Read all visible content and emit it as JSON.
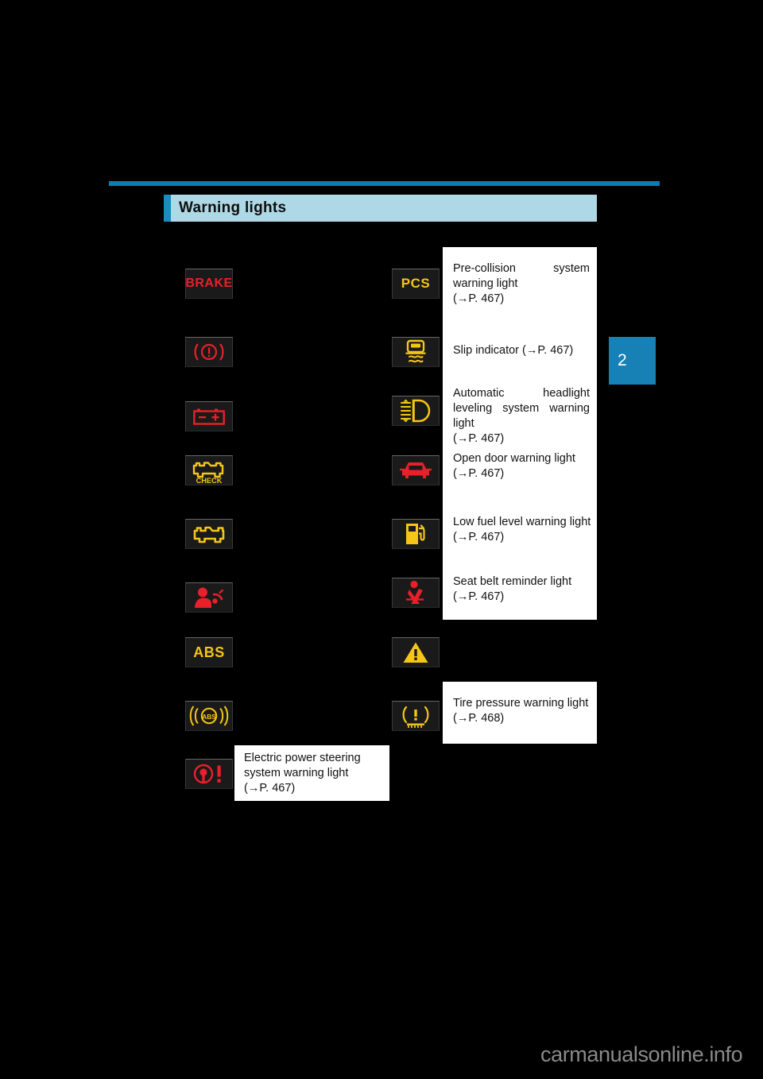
{
  "page": {
    "background_color": "#000000",
    "section_title": "Warning lights",
    "chapter_tab": "2",
    "watermark": "carmanualsonline.info",
    "accent_color": "#1a8dc0",
    "header_band_color": "#aed8e6",
    "rule_color": "#0d7cb5"
  },
  "left_column": [
    {
      "icon": "brake-warning-icon",
      "label_text": "BRAKE",
      "color": "#e8202a"
    },
    {
      "icon": "brake-system-circle-icon",
      "label_text": "",
      "color": "#e8202a"
    },
    {
      "icon": "battery-charge-warning-icon",
      "label_text": "",
      "color": "#e8202a"
    },
    {
      "icon": "engine-check-icon",
      "label_text": "CHECK",
      "color": "#f5c518"
    },
    {
      "icon": "malfunction-indicator-icon",
      "label_text": "",
      "color": "#f5c518"
    },
    {
      "icon": "srs-airbag-warning-icon",
      "label_text": "",
      "color": "#e8202a"
    },
    {
      "icon": "abs-warning-icon",
      "label_text": "ABS",
      "color": "#f5c518"
    },
    {
      "icon": "brake-assist-abs-icon",
      "label_text": "",
      "color": "#f5c518"
    },
    {
      "icon": "electric-power-steering-icon",
      "label_text": "",
      "color": "#e8202a"
    }
  ],
  "right_column": [
    {
      "icon": "pcs-warning-icon",
      "label_text": "PCS",
      "color": "#f5c518"
    },
    {
      "icon": "slip-indicator-icon",
      "label_text": "",
      "color": "#f5c518"
    },
    {
      "icon": "headlight-leveling-icon",
      "label_text": "",
      "color": "#f5c518"
    },
    {
      "icon": "open-door-warning-icon",
      "label_text": "",
      "color": "#e8202a"
    },
    {
      "icon": "low-fuel-warning-icon",
      "label_text": "",
      "color": "#f5c518"
    },
    {
      "icon": "seat-belt-reminder-icon",
      "label_text": "",
      "color": "#e8202a"
    },
    {
      "icon": "master-warning-triangle-icon",
      "label_text": "",
      "color": "#f5c518"
    },
    {
      "icon": "tire-pressure-warning-icon",
      "label_text": "",
      "color": "#f5c518"
    }
  ],
  "callouts": {
    "pre_collision": "Pre-collision system warning light\n(→P. 467)",
    "slip_indicator": "Slip indicator (→P. 467)",
    "headlight_leveling": "Automatic headlight leveling system warning light\n(→P. 467)",
    "open_door": "Open door warning light\n(→P. 467)",
    "low_fuel": "Low fuel level warning light\n(→P. 467)",
    "seat_belt": "Seat belt reminder light\n(→P. 467)",
    "tire_pressure": "Tire pressure warning light\n(→P. 468)",
    "electric_power_steering": "Electric power steering system warning light\n(→P. 467)"
  }
}
